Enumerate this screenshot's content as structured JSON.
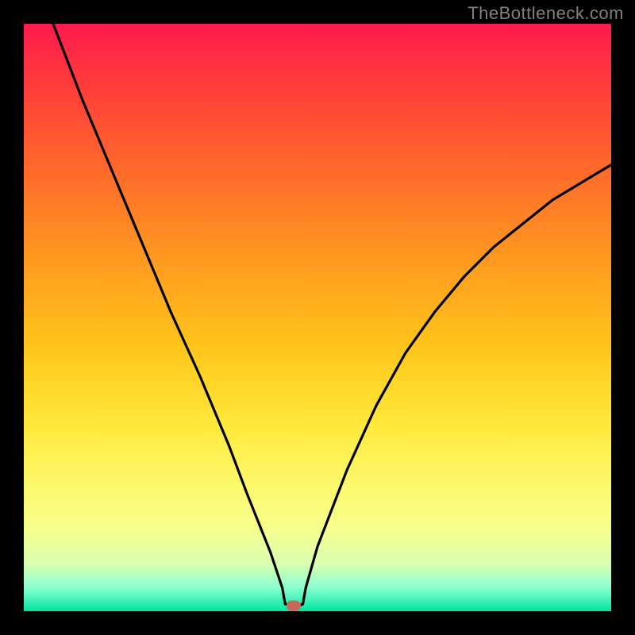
{
  "watermark": "TheBottleneck.com",
  "chart_data": {
    "type": "line",
    "title": "",
    "xlabel": "",
    "ylabel": "",
    "xlim": [
      0,
      100
    ],
    "ylim": [
      0,
      100
    ],
    "grid": false,
    "legend": false,
    "series": [
      {
        "name": "curve",
        "color": "#000000",
        "x": [
          5,
          10,
          15,
          20,
          25,
          30,
          35,
          38,
          40,
          42,
          44,
          44.5,
          47,
          47.5,
          48,
          50,
          55,
          60,
          65,
          70,
          75,
          80,
          85,
          90,
          95,
          100
        ],
        "values": [
          100,
          87,
          75,
          63,
          51,
          40,
          28,
          20,
          15,
          10,
          4,
          1.2,
          1,
          1.2,
          4,
          11,
          24,
          35,
          44,
          51,
          57,
          62,
          66,
          70,
          73,
          76
        ]
      }
    ],
    "marker": {
      "x": 46,
      "y": 1,
      "color": "#c56a56"
    },
    "background_gradient": {
      "top": "#ff1a4d",
      "bottom": "#00e6a0"
    },
    "frame_color": "#000000"
  }
}
